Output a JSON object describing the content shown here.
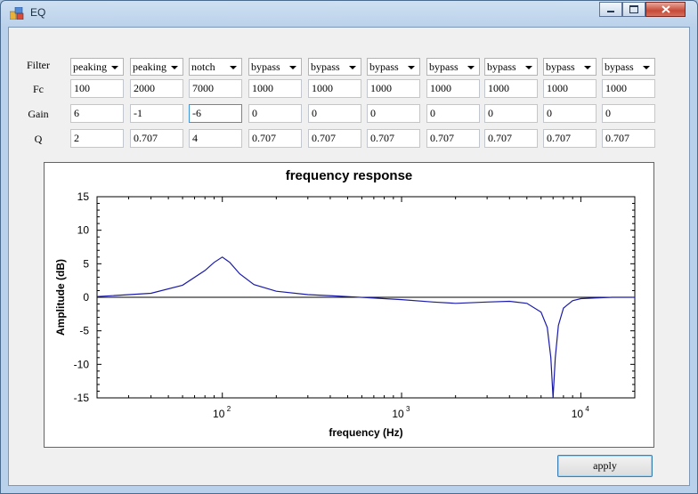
{
  "window": {
    "title": "EQ"
  },
  "params": {
    "labels": {
      "filter": "Filter",
      "fc": "Fc",
      "gain": "Gain",
      "q": "Q"
    },
    "bands": [
      {
        "filter": "peaking",
        "fc": "100",
        "gain": "6",
        "q": "2"
      },
      {
        "filter": "peaking",
        "fc": "2000",
        "gain": "-1",
        "q": "0.707"
      },
      {
        "filter": "notch",
        "fc": "7000",
        "gain": "-6",
        "q": "4"
      },
      {
        "filter": "bypass",
        "fc": "1000",
        "gain": "0",
        "q": "0.707"
      },
      {
        "filter": "bypass",
        "fc": "1000",
        "gain": "0",
        "q": "0.707"
      },
      {
        "filter": "bypass",
        "fc": "1000",
        "gain": "0",
        "q": "0.707"
      },
      {
        "filter": "bypass",
        "fc": "1000",
        "gain": "0",
        "q": "0.707"
      },
      {
        "filter": "bypass",
        "fc": "1000",
        "gain": "0",
        "q": "0.707"
      },
      {
        "filter": "bypass",
        "fc": "1000",
        "gain": "0",
        "q": "0.707"
      },
      {
        "filter": "bypass",
        "fc": "1000",
        "gain": "0",
        "q": "0.707"
      }
    ]
  },
  "chart_data": {
    "type": "line",
    "title": "frequency response",
    "xlabel": "frequency (Hz)",
    "ylabel": "Amplitude (dB)",
    "xscale": "log",
    "xlim": [
      20,
      20000
    ],
    "ylim": [
      -15,
      15
    ],
    "y_ticks": [
      15,
      10,
      5,
      0,
      -5,
      -10,
      -15
    ],
    "x_tick_labels": [
      {
        "base": "10",
        "exp": "2",
        "value": 100
      },
      {
        "base": "10",
        "exp": "3",
        "value": 1000
      },
      {
        "base": "10",
        "exp": "4",
        "value": 10000
      }
    ],
    "zero_line": true,
    "series_color": "#1a1aa8",
    "series": [
      {
        "x": [
          20,
          40,
          60,
          80,
          90,
          100,
          110,
          125,
          150,
          200,
          300,
          500,
          800,
          1000,
          1500,
          2000,
          3000,
          4000,
          5000,
          6000,
          6500,
          6800,
          7000,
          7200,
          7500,
          8000,
          9000,
          10000,
          12000,
          15000,
          20000
        ],
        "y": [
          0.1,
          0.6,
          1.8,
          4.0,
          5.2,
          6.0,
          5.2,
          3.5,
          1.9,
          0.9,
          0.4,
          0.1,
          -0.2,
          -0.35,
          -0.7,
          -0.9,
          -0.7,
          -0.6,
          -0.9,
          -2.2,
          -4.5,
          -9.0,
          -15,
          -9.0,
          -4.2,
          -1.6,
          -0.5,
          -0.2,
          -0.1,
          0.0,
          0.0
        ]
      }
    ]
  },
  "actions": {
    "apply": "apply"
  },
  "colors": {
    "client_bg": "#f0f0f0",
    "focus_border": "#3d95d8",
    "curve": "#1a1aa8"
  }
}
